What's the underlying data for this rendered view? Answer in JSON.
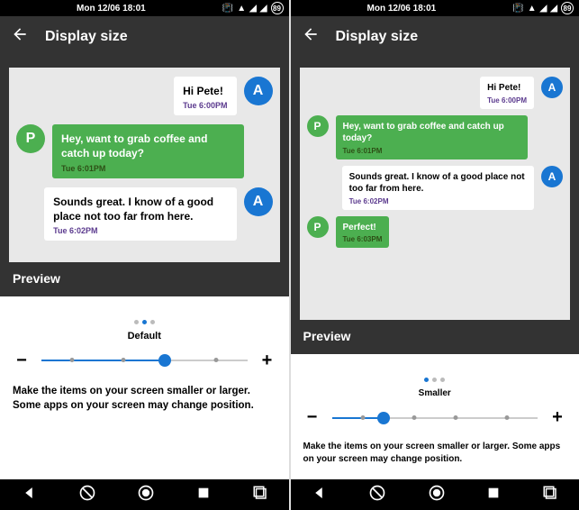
{
  "status": {
    "time": "Mon 12/06 18:01",
    "battery": "89"
  },
  "appbar": {
    "title": "Display size"
  },
  "left": {
    "messages": [
      {
        "side": "right",
        "color": "white",
        "avatar": "A",
        "avcolor": "blue",
        "text": "Hi Pete!",
        "ts": "Tue 6:00PM"
      },
      {
        "side": "left",
        "color": "green",
        "avatar": "P",
        "avcolor": "grn",
        "text": "Hey, want to grab coffee and catch up today?",
        "ts": "Tue 6:01PM"
      },
      {
        "side": "right",
        "color": "white",
        "avatar": "A",
        "avcolor": "blue",
        "text": "Sounds great. I know of a good place not too far from here.",
        "ts": "Tue 6:02PM"
      }
    ],
    "preview": "Preview",
    "size_label": "Default",
    "desc": "Make the items on your screen smaller or larger. Some apps on your screen may change position.",
    "thumb_pct": 60,
    "active_dot": 1
  },
  "right": {
    "messages": [
      {
        "side": "right",
        "color": "white",
        "avatar": "A",
        "avcolor": "blue",
        "text": "Hi Pete!",
        "ts": "Tue 6:00PM"
      },
      {
        "side": "left",
        "color": "green",
        "avatar": "P",
        "avcolor": "grn",
        "text": "Hey, want to grab coffee and catch up today?",
        "ts": "Tue 6:01PM"
      },
      {
        "side": "right",
        "color": "white",
        "avatar": "A",
        "avcolor": "blue",
        "text": "Sounds great. I know of a good place not too far from here.",
        "ts": "Tue 6:02PM"
      },
      {
        "side": "left",
        "color": "green",
        "avatar": "P",
        "avcolor": "grn",
        "text": "Perfect!",
        "ts": "Tue 6:03PM"
      }
    ],
    "preview": "Preview",
    "size_label": "Smaller",
    "desc": "Make the items on your screen smaller or larger. Some apps on your screen may change position.",
    "thumb_pct": 25,
    "active_dot": 0
  },
  "minus": "−",
  "plus": "+"
}
